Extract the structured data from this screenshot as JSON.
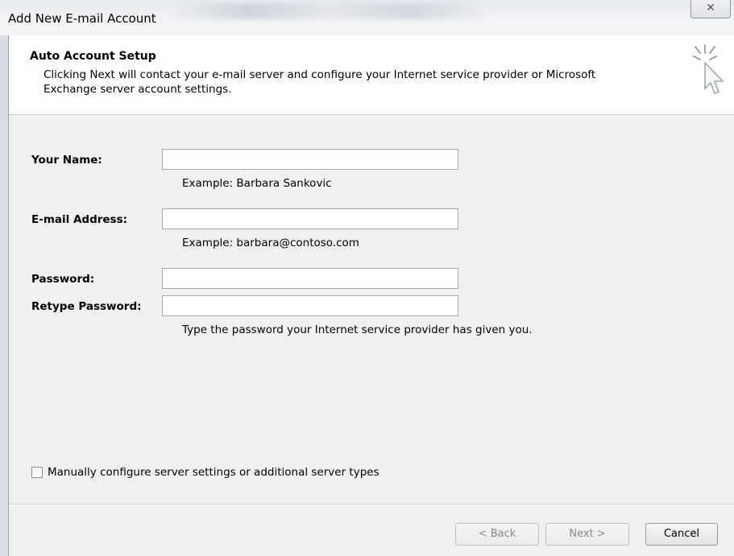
{
  "window": {
    "title": "Add New E-mail Account",
    "close_glyph": "✕"
  },
  "header": {
    "title": "Auto Account Setup",
    "description": "Clicking Next will contact your e-mail server and configure your Internet service provider or Microsoft Exchange server account settings.",
    "icon": "wizard-cursor-icon"
  },
  "form": {
    "name": {
      "label": "Your Name:",
      "value": "",
      "hint": "Example: Barbara Sankovic"
    },
    "email": {
      "label": "E-mail Address:",
      "value": "",
      "hint": "Example: barbara@contoso.com"
    },
    "password": {
      "label": "Password:",
      "value": ""
    },
    "retype": {
      "label": "Retype Password:",
      "value": "",
      "hint": "Type the password your Internet service provider has given you."
    }
  },
  "manual_config": {
    "label": "Manually configure server settings or additional server types",
    "checked": false
  },
  "buttons": {
    "back": "< Back",
    "next": "Next >",
    "cancel": "Cancel"
  }
}
